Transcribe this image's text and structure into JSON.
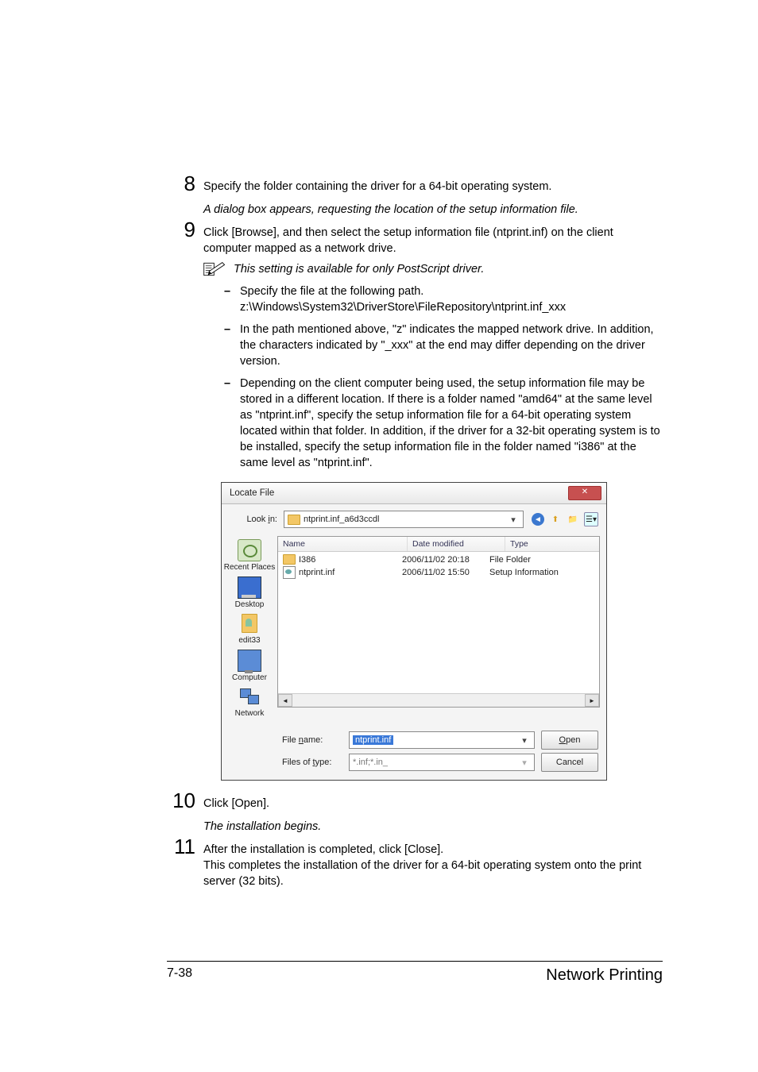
{
  "steps": {
    "s8": {
      "num": "8",
      "text": "Specify the folder containing the driver for a 64-bit operating system.",
      "result": "A dialog box appears, requesting the location of the setup information file."
    },
    "s9": {
      "num": "9",
      "text": "Click [Browse], and then select the setup information file (ntprint.inf) on the client computer mapped as a network drive."
    },
    "note": "This setting is available for only PostScript driver.",
    "b1": {
      "l1": "Specify the file at the following path.",
      "l2": "z:\\Windows\\System32\\DriverStore\\FileRepository\\ntprint.inf_xxx"
    },
    "b2": "In the path mentioned above, \"z\" indicates the mapped network drive. In addition, the characters indicated by \"_xxx\" at the end may differ depending on the driver version.",
    "b3": "Depending on the client computer being used, the setup information file may be stored in a different location. If there is a folder named \"amd64\" at the same level as \"ntprint.inf\", specify the setup information file for a 64-bit operating system located within that folder. In addition, if the driver for a 32-bit operating system is to be installed, specify the setup information file in the folder named \"i386\" at the same level as \"ntprint.inf\".",
    "s10": {
      "num": "10",
      "text": "Click [Open].",
      "result": "The installation begins."
    },
    "s11": {
      "num": "11",
      "l1": "After the installation is completed, click [Close].",
      "l2": "This completes the installation of the driver for a 64-bit operating system onto the print server (32 bits)."
    }
  },
  "dialog": {
    "title": "Locate File",
    "lookin_label": "Look in:",
    "lookin_value": "ntprint.inf_a6d3ccdl",
    "headers": {
      "name": "Name",
      "date": "Date modified",
      "type": "Type"
    },
    "rows": [
      {
        "name": "I386",
        "date": "2006/11/02 20:18",
        "type": "File Folder",
        "kind": "folder"
      },
      {
        "name": "ntprint.inf",
        "date": "2006/11/02 15:50",
        "type": "Setup Information",
        "kind": "inf"
      }
    ],
    "places": {
      "recent": "Recent Places",
      "desktop": "Desktop",
      "user": "edit33",
      "computer": "Computer",
      "network": "Network"
    },
    "filename_label": "File name:",
    "filename_value": "ntprint.inf",
    "filetype_label": "Files of type:",
    "filetype_value": "*.inf;*.in_",
    "open": "Open",
    "cancel": "Cancel"
  },
  "footer": {
    "page": "7-38",
    "title": "Network Printing"
  }
}
